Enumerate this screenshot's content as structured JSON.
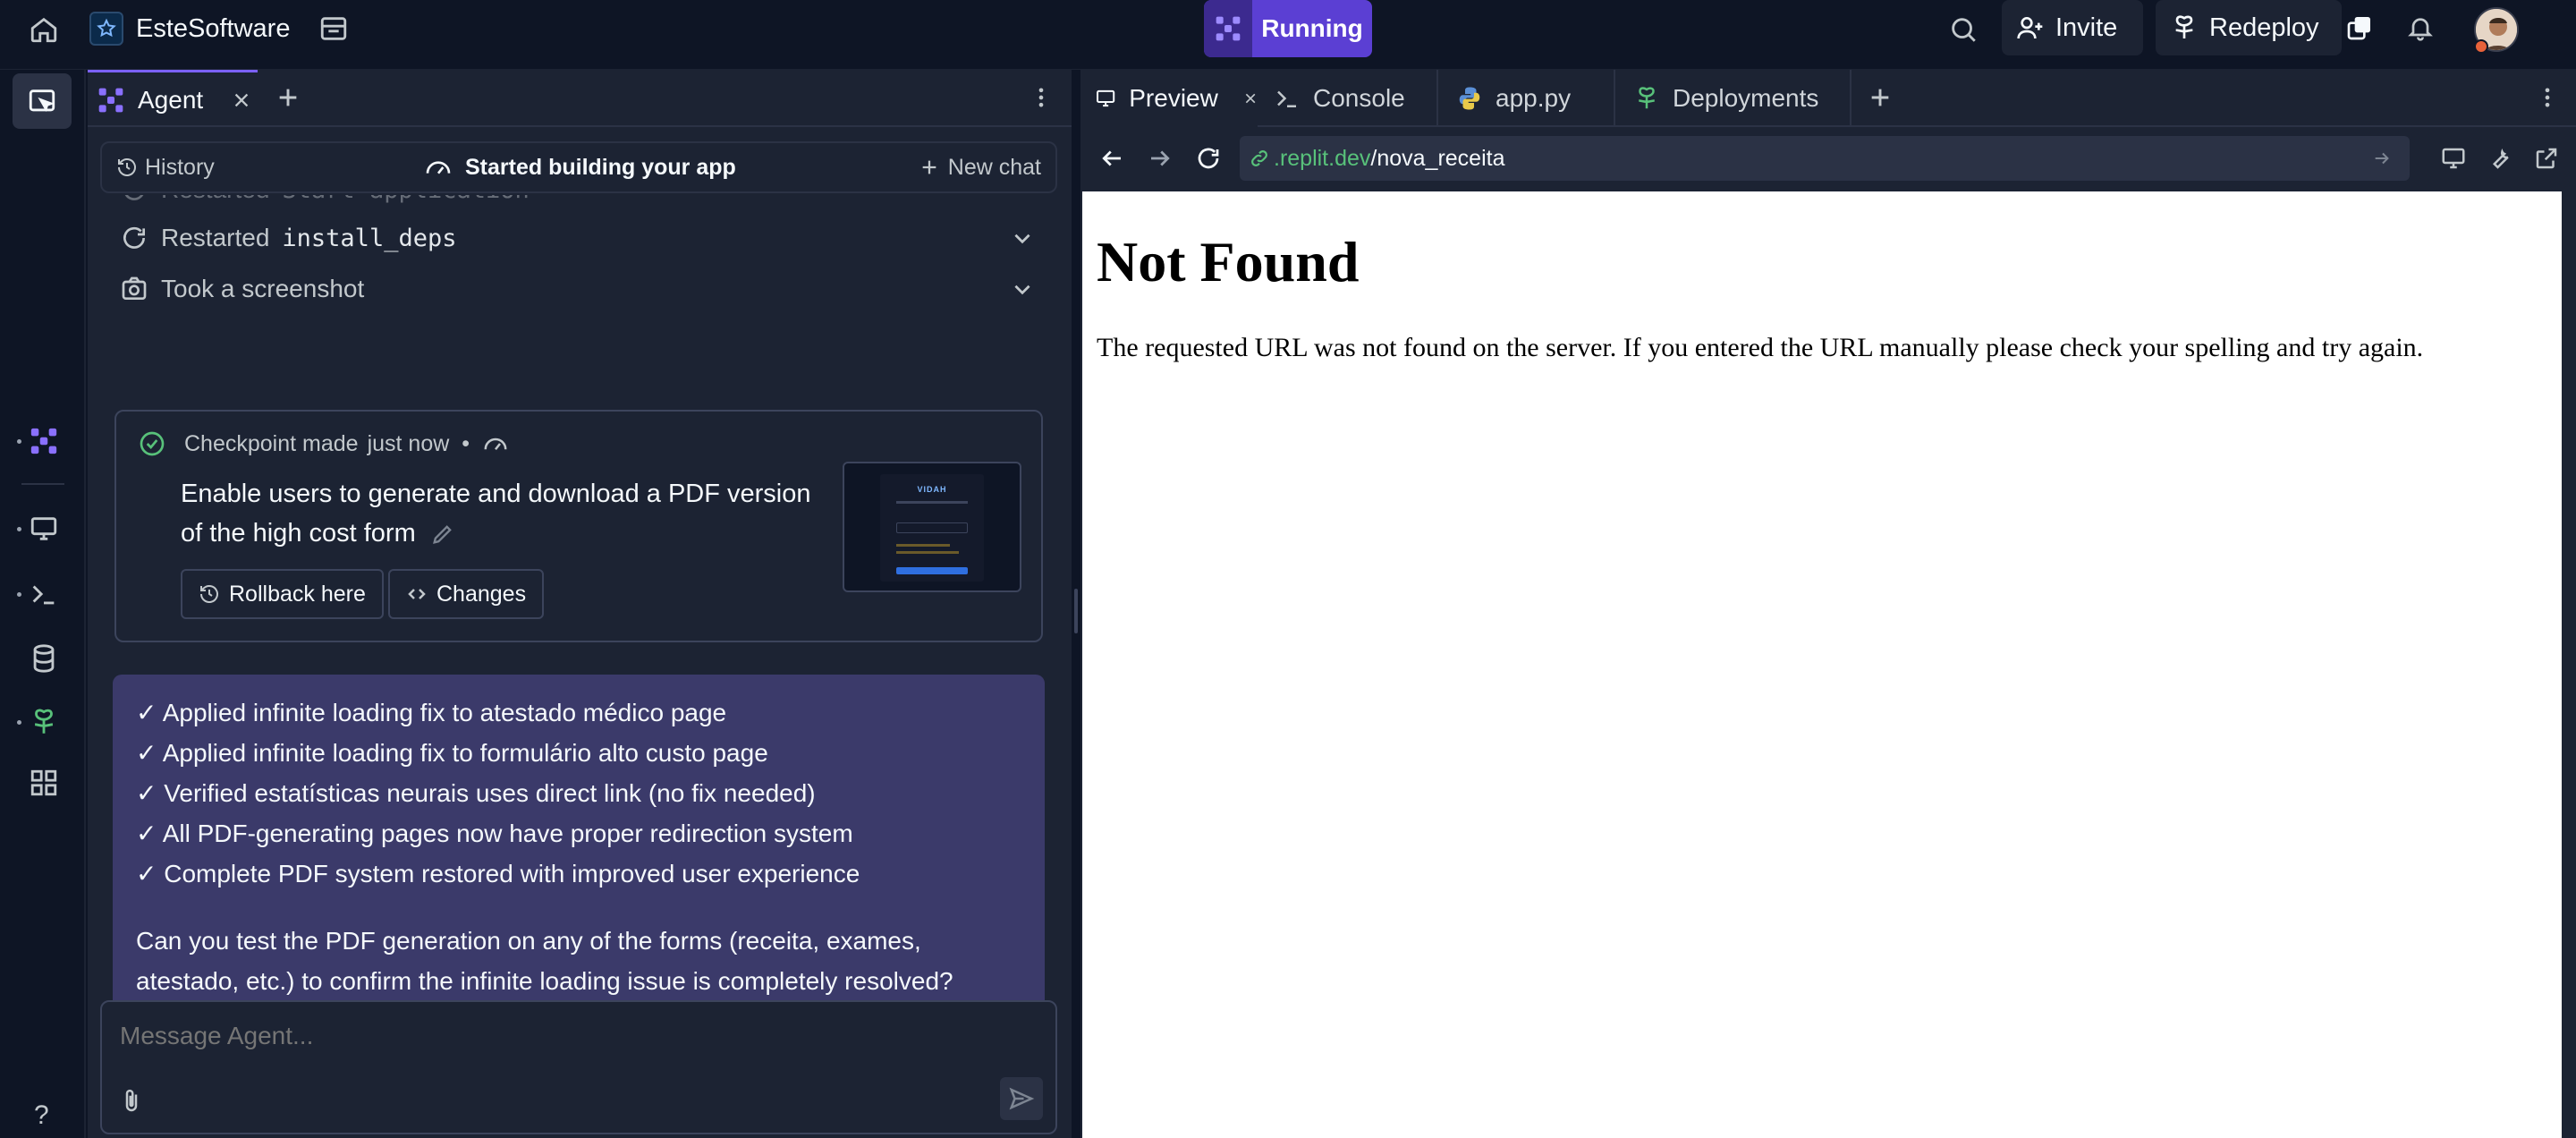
{
  "topbar": {
    "workspace_name": "EsteSoftware",
    "run_label": "Running",
    "invite_label": "Invite",
    "redeploy_label": "Redeploy"
  },
  "agent": {
    "tab_label": "Agent",
    "history_label": "History",
    "status_label": "Started building your app",
    "new_chat_label": "New chat",
    "log_items": [
      {
        "prefix": "Restarted",
        "code": "Start application"
      },
      {
        "prefix": "Restarted",
        "code": "install_deps"
      },
      {
        "prefix": "Took a screenshot",
        "code": ""
      }
    ],
    "checkpoint": {
      "title": "Checkpoint made",
      "time": "just now",
      "dot": "•",
      "description": "Enable users to generate and download a PDF version of the high cost form",
      "rollback_label": "Rollback here",
      "changes_label": "Changes",
      "thumb_title": "VIDAH"
    },
    "message": {
      "lines": [
        "✓ Applied infinite loading fix to atestado médico page",
        "✓ Applied infinite loading fix to formulário alto custo page",
        "✓ Verified estatísticas neurais uses direct link (no fix needed)",
        "✓ All PDF-generating pages now have proper redirection system",
        "✓ Complete PDF system restored with improved user experience"
      ],
      "question": "Can you test the PDF generation on any of the forms (receita, exames, atestado, etc.) to confirm the infinite loading issue is completely resolved?"
    },
    "input_placeholder": "Message Agent..."
  },
  "preview": {
    "tabs": [
      {
        "label": "Preview",
        "icon": "monitor-icon",
        "active": true
      },
      {
        "label": "Console",
        "icon": "terminal-icon",
        "active": false
      },
      {
        "label": "app.py",
        "icon": "python-icon",
        "active": false
      },
      {
        "label": "Deployments",
        "icon": "deploy-icon",
        "active": false
      }
    ],
    "url_domain": ".replit.dev",
    "url_path": "/nova_receita",
    "page_heading": "Not Found",
    "page_body": "The requested URL was not found on the server. If you entered the URL manually please check your spelling and try again."
  },
  "rail": {
    "help_label": "?"
  },
  "colors": {
    "background": "#0e1525",
    "panel": "#1c2333",
    "accent": "#7b61ff",
    "run_button": "#5b3fd3",
    "message_bg": "#3b3a6a",
    "url_green": "#58c17a"
  }
}
